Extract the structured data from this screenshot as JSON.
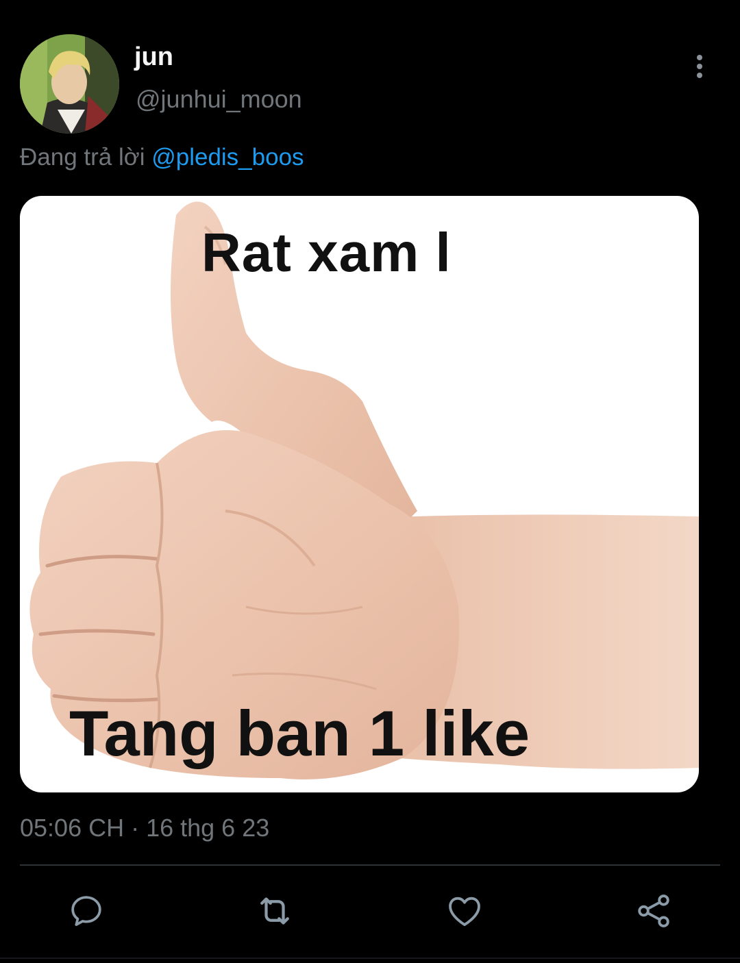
{
  "tweet": {
    "author": {
      "display_name": "jun",
      "handle": "@junhui_moon"
    },
    "reply_context": {
      "prefix": "Đang trả lời",
      "mention": "@pledis_boos"
    },
    "media": {
      "top_text": "Rat xam l",
      "bottom_text": "Tang ban 1 like"
    },
    "timestamp": "05:06 CH · 16 thg 6 23"
  },
  "icons": {
    "more": "more-vertical-icon",
    "reply": "reply-icon",
    "retweet": "retweet-icon",
    "like": "heart-icon",
    "share": "share-icon"
  },
  "colors": {
    "background": "#000000",
    "secondary_text": "#71767b",
    "accent": "#1d9bf0",
    "icon": "#8b9ba8"
  }
}
